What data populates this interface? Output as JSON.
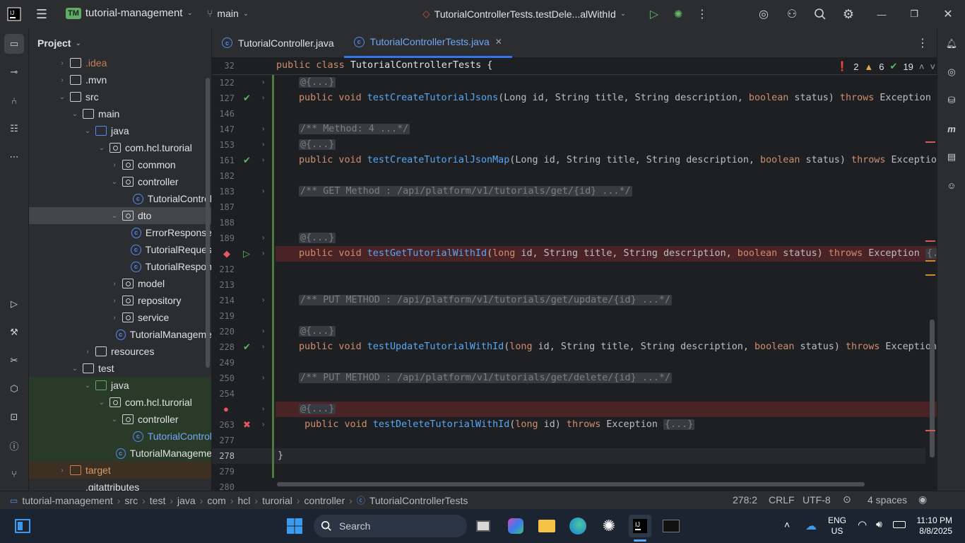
{
  "titlebar": {
    "project_badge": "TM",
    "project_name": "tutorial-management",
    "branch": "main",
    "run_config": "TutorialControllerTests.testDele...alWithId"
  },
  "project_panel": {
    "title": "Project",
    "tree": [
      {
        "label": ".idea",
        "depth": 1,
        "arrow": "›",
        "kind": "folder",
        "color": "#c77d55"
      },
      {
        "label": ".mvn",
        "depth": 1,
        "arrow": "›",
        "kind": "folder"
      },
      {
        "label": "src",
        "depth": 1,
        "arrow": "⌄",
        "kind": "folder"
      },
      {
        "label": "main",
        "depth": 2,
        "arrow": "⌄",
        "kind": "folder"
      },
      {
        "label": "java",
        "depth": 3,
        "arrow": "⌄",
        "kind": "srcf"
      },
      {
        "label": "com.hcl.turorial",
        "depth": 4,
        "arrow": "⌄",
        "kind": "pkg"
      },
      {
        "label": "common",
        "depth": 5,
        "arrow": "›",
        "kind": "pkg"
      },
      {
        "label": "controller",
        "depth": 5,
        "arrow": "⌄",
        "kind": "pkg"
      },
      {
        "label": "TutorialControl",
        "depth": 6,
        "arrow": "",
        "kind": "cls"
      },
      {
        "label": "dto",
        "depth": 5,
        "arrow": "⌄",
        "kind": "pkg",
        "selected": true
      },
      {
        "label": "ErrorResponse",
        "depth": 6,
        "arrow": "",
        "kind": "cls"
      },
      {
        "label": "TutorialReques",
        "depth": 6,
        "arrow": "",
        "kind": "cls"
      },
      {
        "label": "TutorialRespon",
        "depth": 6,
        "arrow": "",
        "kind": "cls"
      },
      {
        "label": "model",
        "depth": 5,
        "arrow": "›",
        "kind": "pkg"
      },
      {
        "label": "repository",
        "depth": 5,
        "arrow": "›",
        "kind": "pkg"
      },
      {
        "label": "service",
        "depth": 5,
        "arrow": "›",
        "kind": "pkg"
      },
      {
        "label": "TutorialManageme",
        "depth": 5,
        "arrow": "",
        "kind": "cls"
      },
      {
        "label": "resources",
        "depth": 3,
        "arrow": "›",
        "kind": "folder"
      },
      {
        "label": "test",
        "depth": 2,
        "arrow": "⌄",
        "kind": "folder"
      },
      {
        "label": "java",
        "depth": 3,
        "arrow": "⌄",
        "kind": "testf",
        "green": true
      },
      {
        "label": "com.hcl.turorial",
        "depth": 4,
        "arrow": "⌄",
        "kind": "pkg",
        "green": true
      },
      {
        "label": "controller",
        "depth": 5,
        "arrow": "⌄",
        "kind": "pkg",
        "green": true
      },
      {
        "label": "TutorialControl",
        "depth": 6,
        "arrow": "",
        "kind": "cls",
        "green": true,
        "blue": true
      },
      {
        "label": "TutorialManageme",
        "depth": 5,
        "arrow": "",
        "kind": "cls",
        "green": true
      },
      {
        "label": "target",
        "depth": 1,
        "arrow": "›",
        "kind": "exf",
        "orange": true
      },
      {
        "label": ".gitattributes",
        "depth": 1,
        "arrow": "",
        "kind": "file"
      }
    ]
  },
  "tabs": [
    {
      "label": "TutorialController.java",
      "active": false
    },
    {
      "label": "TutorialControllerTests.java",
      "active": true
    }
  ],
  "inspections": {
    "errors": "2",
    "warnings": "6",
    "ok": "19"
  },
  "sticky_line": {
    "num": "32",
    "text": "public class TutorialControllerTests {"
  },
  "lines": [
    {
      "num": "122",
      "html": "<span class='fold-box'>@{...}</span>",
      "fold": true
    },
    {
      "num": "127",
      "html": "<span class='kw'>public void </span><span class='fn'>testCreateTutorialJsons</span>(Long id, String title, String description, <span class='kw'>boolean</span> status) <span class='kw'>throws</span> Exception <span class='fold-box'>{</span>",
      "fold": true,
      "gutter": "pass"
    },
    {
      "num": "146",
      "html": ""
    },
    {
      "num": "147",
      "html": "<span class='fold-box cm'>/** Method: 4 ...*/</span>",
      "fold": true
    },
    {
      "num": "153",
      "html": "<span class='fold-box'>@{...}</span>",
      "fold": true
    },
    {
      "num": "161",
      "html": "<span class='kw'>public void </span><span class='fn'>testCreateTutorialJsonMap</span>(Long id, String title, String description, <span class='kw'>boolean</span> status) <span class='kw'>throws</span> Exception",
      "fold": true,
      "gutter": "pass"
    },
    {
      "num": "182",
      "html": ""
    },
    {
      "num": "183",
      "html": "<span class='fold-box cm'>/** GET Method : /api/platform/v1/tutorials/get/{id} ...*/</span>",
      "fold": true
    },
    {
      "num": "187",
      "html": ""
    },
    {
      "num": "188",
      "html": ""
    },
    {
      "num": "189",
      "html": "<span class='fold-box'>@{...}</span>",
      "fold": true
    },
    {
      "num": "",
      "html": "<span class='kw'>public void </span><span class='fn'>testGetTutorialWithId</span>(<span class='kw'>long</span> id, String title, String description, <span class='kw'>boolean</span> status) <span class='kw'>throws</span> Exception <span class='fold-box'>{...</span>",
      "fold": true,
      "gutter": "bp-run",
      "hl": true
    },
    {
      "num": "212",
      "html": ""
    },
    {
      "num": "213",
      "html": ""
    },
    {
      "num": "214",
      "html": "<span class='fold-box cm'>/** PUT METHOD : /api/platform/v1/tutorials/get/update/{id} ...*/</span>",
      "fold": true
    },
    {
      "num": "219",
      "html": ""
    },
    {
      "num": "220",
      "html": "<span class='fold-box'>@{...}</span>",
      "fold": true
    },
    {
      "num": "228",
      "html": "<span class='kw'>public void </span><span class='fn'>testUpdateTutorialWithId</span>(<span class='kw'>long</span> id, String title, String description, <span class='kw'>boolean</span> status) <span class='kw'>throws</span> Exception<span class='fold-box'>{</span>",
      "fold": true,
      "gutter": "pass"
    },
    {
      "num": "249",
      "html": ""
    },
    {
      "num": "250",
      "html": "<span class='fold-box cm'>/** PUT METHOD : /api/platform/v1/tutorials/get/delete/{id} ...*/</span>",
      "fold": true
    },
    {
      "num": "254",
      "html": ""
    },
    {
      "num": "",
      "html": "<span class='fold-box'>@{...}</span>",
      "fold": true,
      "gutter": "bp",
      "hl": true
    },
    {
      "num": "263",
      "html": " <span class='kw'>public void </span><span class='fn'>testDeleteTutorialWithId</span>(<span class='kw'>long</span> id) <span class='kw'>throws</span> Exception <span class='fold-box'>{...}</span>",
      "fold": true,
      "gutter": "fail"
    },
    {
      "num": "277",
      "html": ""
    },
    {
      "num": "278",
      "html": "}",
      "current": true
    },
    {
      "num": "279",
      "html": ""
    },
    {
      "num": "280",
      "html": ""
    }
  ],
  "statusbar": {
    "breadcrumbs": [
      "tutorial-management",
      "src",
      "test",
      "java",
      "com",
      "hcl",
      "turorial",
      "controller",
      "TutorialControllerTests"
    ],
    "position": "278:2",
    "line_sep": "CRLF",
    "encoding": "UTF-8",
    "indent": "4 spaces"
  },
  "taskbar": {
    "search_placeholder": "Search",
    "lang_top": "ENG",
    "lang_bottom": "US",
    "time": "11:10 PM",
    "date": "8/8/2025"
  }
}
